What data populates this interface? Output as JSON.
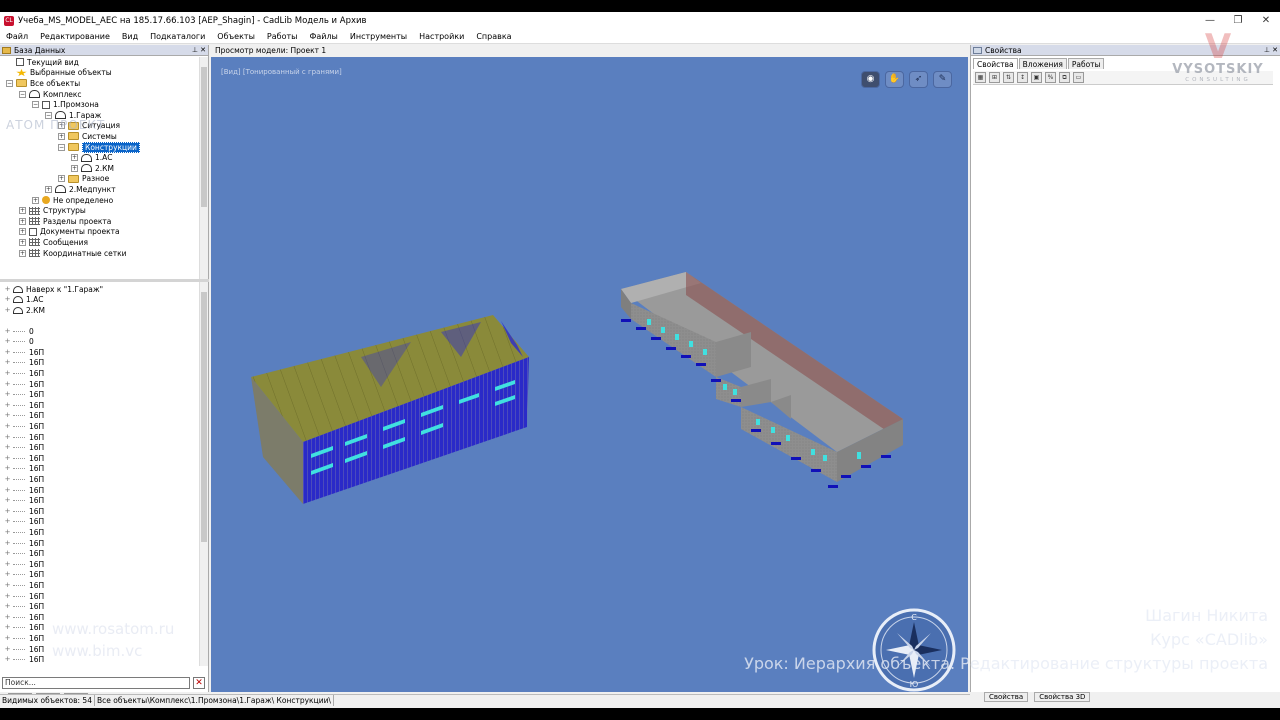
{
  "window": {
    "title": "Учеба_MS_MODEL_AEC на 185.17.66.103 [AEP_Shagin] - CadLib Модель и Архив",
    "min": "—",
    "max": "❐",
    "close": "✕"
  },
  "menu": [
    "Файл",
    "Редактирование",
    "Вид",
    "Подкаталоги",
    "Объекты",
    "Работы",
    "Файлы",
    "Инструменты",
    "Настройки",
    "Справка"
  ],
  "left_panel": {
    "title": "База Данных",
    "tree": [
      {
        "label": "Текущий вид",
        "indent": 0,
        "icon": "doc",
        "exp": ""
      },
      {
        "label": "Выбранные объекты",
        "indent": 0,
        "icon": "star",
        "exp": ""
      },
      {
        "label": "Все объекты",
        "indent": 0,
        "icon": "folder",
        "exp": "−"
      },
      {
        "label": "Комплекс",
        "indent": 1,
        "icon": "house",
        "exp": "−"
      },
      {
        "label": "1.Промзона",
        "indent": 2,
        "icon": "doc",
        "exp": "−"
      },
      {
        "label": "1.Гараж",
        "indent": 3,
        "icon": "house",
        "exp": "−"
      },
      {
        "label": "Ситуация",
        "indent": 4,
        "icon": "folder",
        "exp": "+"
      },
      {
        "label": "Системы",
        "indent": 4,
        "icon": "folder",
        "exp": "+"
      },
      {
        "label": "Конструкции",
        "indent": 4,
        "icon": "folder",
        "exp": "−",
        "selected": true
      },
      {
        "label": "1.АС",
        "indent": 5,
        "icon": "house",
        "exp": "+"
      },
      {
        "label": "2.КМ",
        "indent": 5,
        "icon": "house",
        "exp": "+"
      },
      {
        "label": "Разное",
        "indent": 4,
        "icon": "folder",
        "exp": "+"
      },
      {
        "label": "2.Медпункт",
        "indent": 3,
        "icon": "house",
        "exp": "+"
      },
      {
        "label": "Не определено",
        "indent": 2,
        "icon": "coin",
        "exp": "+"
      },
      {
        "label": "Структуры",
        "indent": 1,
        "icon": "grid",
        "exp": "+"
      },
      {
        "label": "Разделы проекта",
        "indent": 1,
        "icon": "grid",
        "exp": "+"
      },
      {
        "label": "Документы проекта",
        "indent": 1,
        "icon": "doc",
        "exp": "+"
      },
      {
        "label": "Сообщения",
        "indent": 1,
        "icon": "grid",
        "exp": "+"
      },
      {
        "label": "Координатные сетки",
        "indent": 1,
        "icon": "grid",
        "exp": "+"
      }
    ],
    "list_header": [
      {
        "label": "Наверх к \"1.Гараж\"",
        "icon": "house"
      },
      {
        "label": "1.АС",
        "icon": "house"
      },
      {
        "label": "2.КМ",
        "icon": "house"
      }
    ],
    "list_items": [
      "0",
      "0",
      "16П",
      "16П",
      "16П",
      "16П",
      "16П",
      "16П",
      "16П",
      "16П",
      "16П",
      "16П",
      "16П",
      "16П",
      "16П",
      "16П",
      "16П",
      "16П",
      "16П",
      "16П",
      "16П",
      "16П",
      "16П",
      "16П",
      "16П",
      "16П",
      "16П",
      "16П",
      "16П",
      "16П",
      "16П",
      "16П",
      "16П"
    ],
    "search_placeholder": "Поиск...",
    "search_clear": "✕"
  },
  "viewport": {
    "title": "Просмотр модели: Проект 1",
    "tag": "[Вид] [Тонированный с гранями]",
    "tools": [
      "◉",
      "✋",
      "➶",
      "✎"
    ]
  },
  "right_panel": {
    "title": "Свойства",
    "tabs": [
      "Свойства",
      "Вложения",
      "Работы"
    ],
    "tools": [
      "▦",
      "⊞",
      "⇅",
      "↕",
      "▣",
      "%",
      "⧉",
      "▭"
    ],
    "bottom_tabs": [
      "Свойства",
      "Свойства 3D"
    ]
  },
  "status": {
    "visible": "Видимых объектов: 54",
    "path": "Все объекты\\Комплекс\\1.Промзона\\1.Гараж\\ Конструкции\\"
  },
  "overlays": {
    "site1": "www.rosatom.ru",
    "site2": "www.bim.vc",
    "author": "Шагин Никита",
    "course": "Курс «CADlib»",
    "lesson": "Урок: Иерархия объекта. Редактирование структуры проекта",
    "atom": "АТОМ ПРОЕКТ",
    "brand": "VYSOTSKIY",
    "brand_sub": "CONSULTING"
  },
  "compass": {
    "n": "С",
    "s": "Ю"
  },
  "colors": {
    "viewport": "#5a7fbf",
    "selection": "#0a64c8",
    "roof": "#8a8a3a",
    "facade_blue": "#1b1bd6",
    "window_cyan": "#30e0e0",
    "building_gray": "#8c8c8c"
  }
}
